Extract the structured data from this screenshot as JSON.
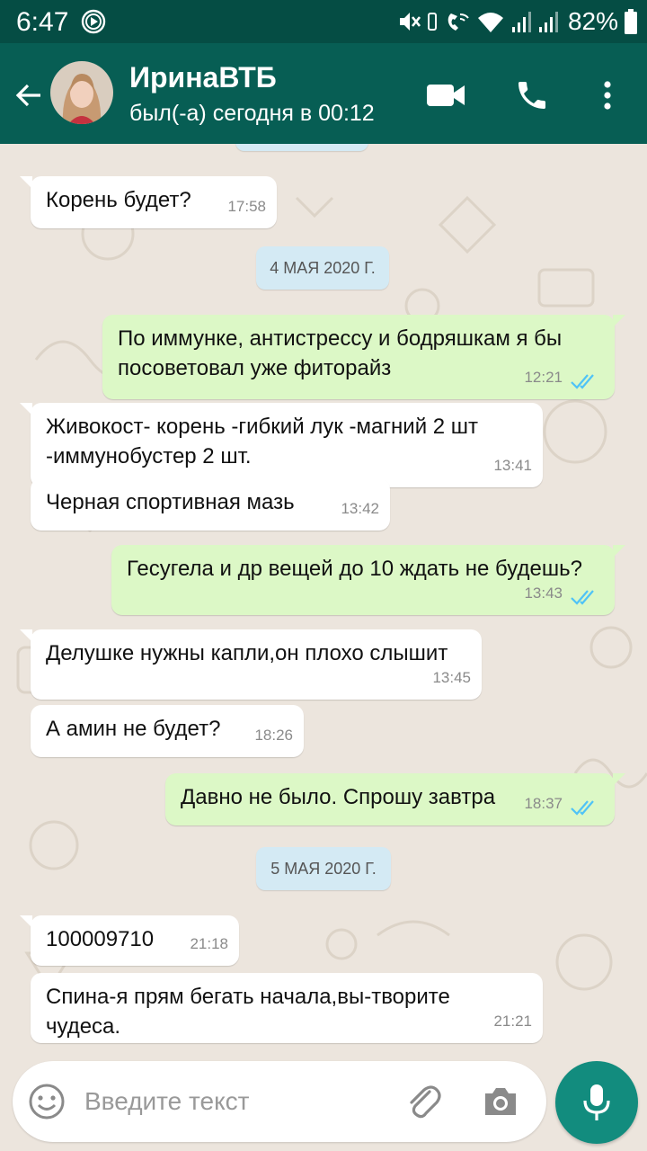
{
  "status_bar": {
    "time": "6:47",
    "battery": "82%",
    "icons": [
      "app-notification-icon",
      "mute-icon",
      "vibrate-icon",
      "wifi-call-icon",
      "wifi-icon",
      "signal-icon",
      "signal-icon",
      "battery-icon"
    ]
  },
  "header": {
    "contact_name": "ИринаВТБ",
    "last_seen": "был(-а) сегодня в 00:12",
    "icons": [
      "back-arrow-icon",
      "video-call-icon",
      "phone-icon",
      "more-vert-icon"
    ]
  },
  "dates": {
    "d1": "4 МАЯ 2020 Г.",
    "d2": "5 МАЯ 2020 Г."
  },
  "messages": [
    {
      "dir": "in",
      "text": "Корень будет?",
      "time": "17:58"
    },
    {
      "dir": "out",
      "text": "По иммунке, антистрессу и бодряшкам я бы посоветовал уже фиторайз",
      "time": "12:21",
      "read": true
    },
    {
      "dir": "in",
      "text": "Живокост- корень -гибкий лук -магний 2 шт -иммунобустер 2 шт.",
      "time": "13:41"
    },
    {
      "dir": "in",
      "text": "Черная спортивная мазь",
      "time": "13:42"
    },
    {
      "dir": "out",
      "text": "Гесугела и др вещей до 10 ждать не будешь?",
      "time": "13:43",
      "read": true
    },
    {
      "dir": "in",
      "text": "Делушке нужны капли,он плохо слышит",
      "time": "13:45"
    },
    {
      "dir": "in",
      "text": "А амин не будет?",
      "time": "18:26"
    },
    {
      "dir": "out",
      "text": "Давно не было. Спрошу завтра",
      "time": "18:37",
      "read": true
    },
    {
      "dir": "in",
      "text": "100009710",
      "time": "21:18"
    },
    {
      "dir": "in",
      "text": "Спина-я прям бегать начала,вы-творите чудеса.",
      "time": "21:21"
    }
  ],
  "composer": {
    "placeholder": "Введите текст",
    "icons": [
      "emoji-icon",
      "attach-icon",
      "camera-icon",
      "mic-icon"
    ]
  },
  "colors": {
    "header": "#075e54",
    "status_bar": "#054d44",
    "outgoing_bubble": "#dcf8c6",
    "incoming_bubble": "#ffffff",
    "date_chip": "#d4eaf4",
    "read_ticks": "#4fc3f7",
    "mic_button": "#128c7e",
    "chat_background": "#ece5dd"
  }
}
